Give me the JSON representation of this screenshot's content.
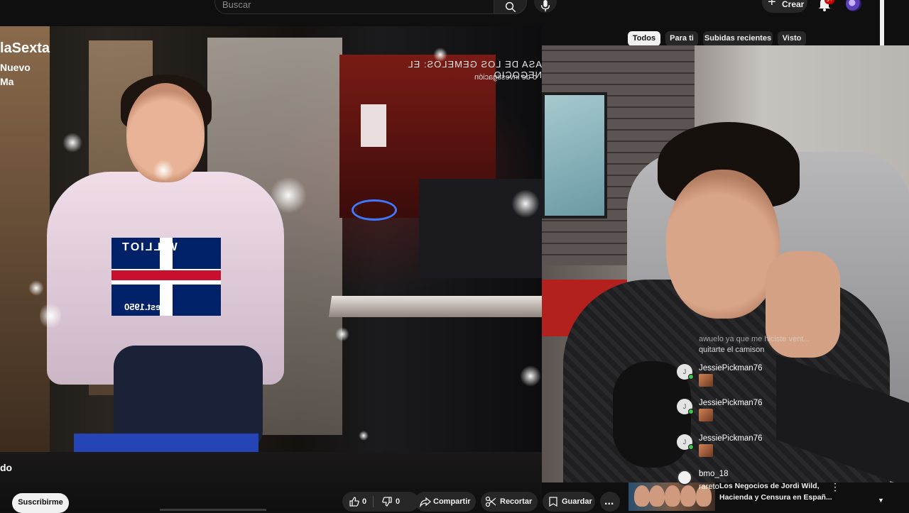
{
  "header": {
    "search_placeholder": "Buscar",
    "create_label": "Crear",
    "notification_count": "9+"
  },
  "chips": [
    {
      "label": "Todos",
      "active": true
    },
    {
      "label": "Para ti",
      "active": false
    },
    {
      "label": "Subidas recientes",
      "active": false
    },
    {
      "label": "Visto",
      "active": false
    }
  ],
  "video": {
    "channel_logo": "laSexta",
    "channel_line1": "Nuevo",
    "channel_line2": "Ma",
    "banner_line1": "ASA DE LOS GEMELOS: EL NEGOCIO",
    "banner_line2": "o de investigación",
    "sweater_text": "WILLIOT",
    "sweater_bottom": "est.1950",
    "title_fragment": "do"
  },
  "chat": {
    "overlay_line1": "awuelo ya que me hiciste vent...",
    "overlay_line2": "quitarte el camison",
    "messages": [
      {
        "initial": "J",
        "name": "JessiePickman76"
      },
      {
        "initial": "J",
        "name": "JessiePickman76"
      },
      {
        "initial": "J",
        "name": "JessiePickman76"
      }
    ],
    "last_name": "bmo_18",
    "last_sub": "rareto"
  },
  "actions": {
    "subscribe_label": "Suscribirme",
    "like_count": "0",
    "dislike_count": "0",
    "share_label": "Compartir",
    "clip_label": "Recortar",
    "save_label": "Guardar",
    "more_label": "..."
  },
  "queue": {
    "title_line1": "Los Negocios de Jordi Wild,",
    "title_line2": "Hacienda y Censura en Españ...",
    "menu_label": "⋮"
  },
  "colors": {
    "background": "#0f0f0f",
    "chip_active": "#f1f1f1",
    "chip_inactive": "#272727",
    "badge_red": "#cc0000",
    "online_green": "#3ec84b"
  }
}
